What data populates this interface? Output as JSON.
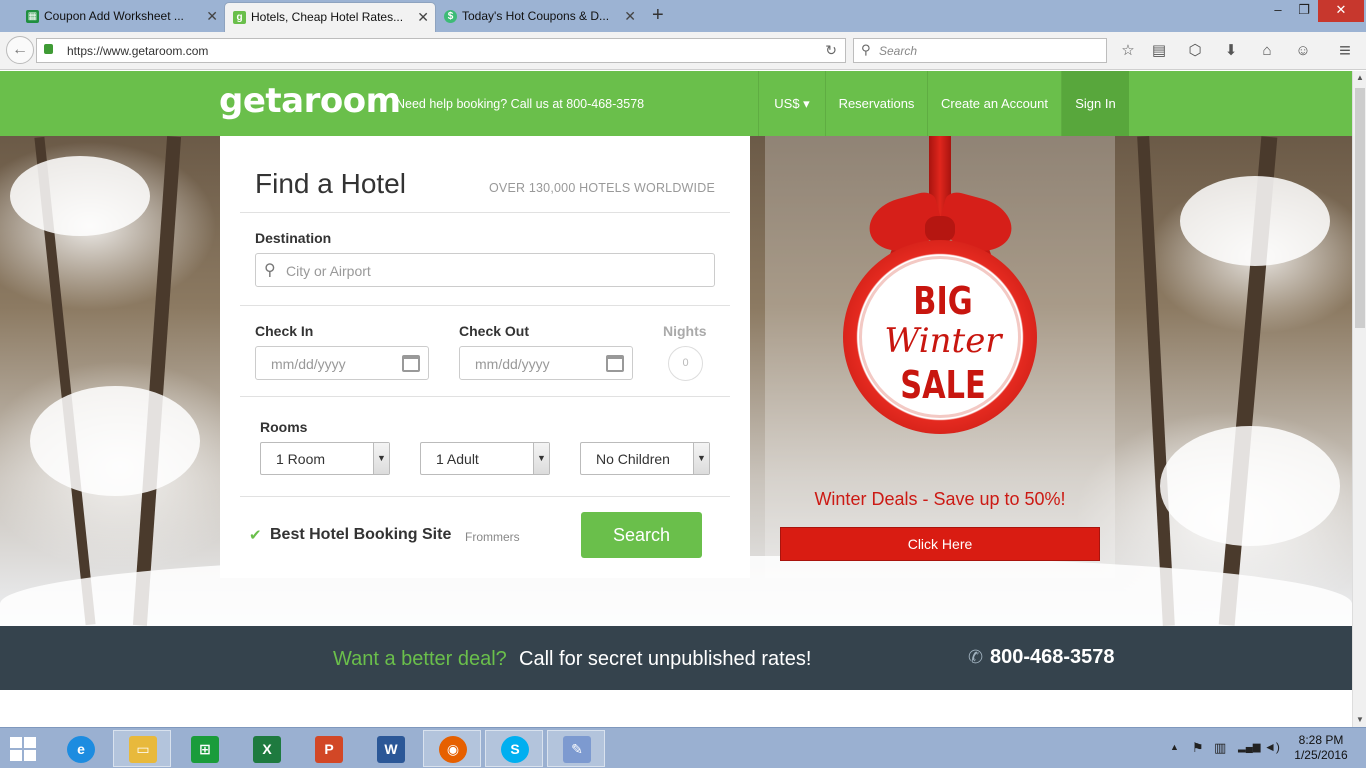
{
  "browser": {
    "tabs": [
      {
        "title": "Coupon Add Worksheet ...",
        "fav_color": "#1f8f3f",
        "fav_glyph": "▦",
        "active": false
      },
      {
        "title": "Hotels, Cheap Hotel Rates...",
        "fav_color": "#6abf4b",
        "fav_glyph": "g",
        "active": true
      },
      {
        "title": "Today's Hot Coupons & D...",
        "fav_color": "#3dbb76",
        "fav_glyph": "$",
        "active": false
      }
    ],
    "tab_close_glyph": "✕",
    "new_tab_glyph": "+",
    "window_controls": {
      "minimize": "–",
      "restore": "❐",
      "close": "✕"
    },
    "back_glyph": "←",
    "url": "https://www.getaroom.com",
    "reload_glyph": "↻",
    "search_placeholder": "Search",
    "search_glyph": "⚲",
    "toolbar_icons": {
      "bookmark": "☆",
      "reader": "▤",
      "pocket": "⬡",
      "download": "⬇",
      "home": "⌂",
      "chat": "☺",
      "menu": "≡"
    }
  },
  "site": {
    "logo": "getaroom",
    "help_text": "Need help booking? Call us at 800-468-3578",
    "nav": {
      "currency": "US$ ▾",
      "reservations": "Reservations",
      "create_account": "Create an Account",
      "sign_in": "Sign In"
    },
    "brand_color": "#6abf4b"
  },
  "form": {
    "title": "Find a Hotel",
    "subtitle": "OVER 130,000 HOTELS WORLDWIDE",
    "destination_label": "Destination",
    "destination_placeholder": "City or Airport",
    "search_glyph": "⚲",
    "checkin_label": "Check In",
    "checkin_placeholder": "mm/dd/yyyy",
    "checkout_label": "Check Out",
    "checkout_placeholder": "mm/dd/yyyy",
    "nights_label": "Nights",
    "nights_value": "0",
    "rooms_label": "Rooms",
    "rooms_value": "1 Room",
    "adults_value": "1 Adult",
    "children_value": "No Children",
    "select_arrow": "▼",
    "check_glyph": "✔",
    "best_site": "Best Hotel Booking Site",
    "best_site_source": "Frommers",
    "search_button": "Search"
  },
  "promo": {
    "badge_big": "BIG",
    "badge_winter": "Winter",
    "badge_sale": "SALE",
    "text": "Winter Deals - Save up to 50%!",
    "button": "Click Here",
    "accent_color": "#d91c12"
  },
  "band": {
    "green_text": "Want a better deal?",
    "white_text": "Call for secret unpublished rates!",
    "phone_glyph": "✆",
    "phone": "800-468-3578"
  },
  "scrollbar": {
    "up": "▲",
    "down": "▼"
  },
  "taskbar": {
    "apps": [
      {
        "name": "internet-explorer",
        "glyph": "e",
        "color": "#1d8ce0"
      },
      {
        "name": "file-explorer",
        "glyph": "▭",
        "color": "#e8b93c"
      },
      {
        "name": "store",
        "glyph": "⊞",
        "color": "#1a9c3a"
      },
      {
        "name": "excel",
        "glyph": "X",
        "color": "#1e7a3f"
      },
      {
        "name": "powerpoint",
        "glyph": "P",
        "color": "#d24726"
      },
      {
        "name": "word",
        "glyph": "W",
        "color": "#2b5797"
      },
      {
        "name": "firefox",
        "glyph": "◉",
        "color": "#e66000"
      },
      {
        "name": "skype",
        "glyph": "S",
        "color": "#00aff0"
      },
      {
        "name": "paint",
        "glyph": "✎",
        "color": "#7d9ad0"
      }
    ],
    "tray": {
      "up": "▲",
      "flag": "⚑",
      "network": "▥",
      "signal": "▂▄▆",
      "volume": "◄)"
    },
    "time": "8:28 PM",
    "date": "1/25/2016"
  }
}
